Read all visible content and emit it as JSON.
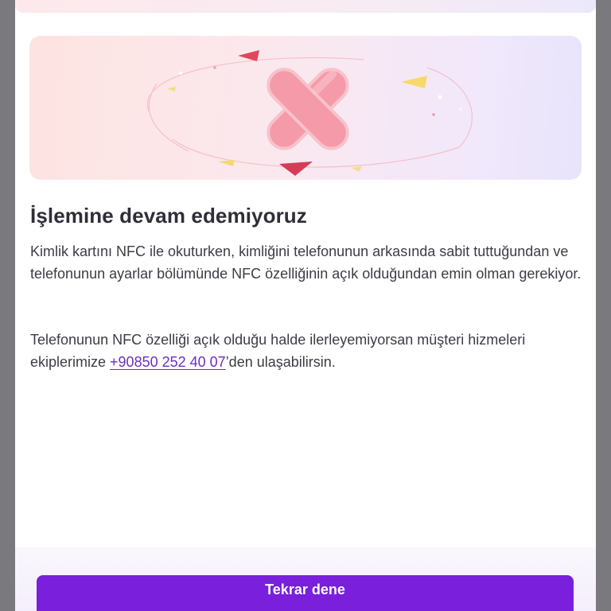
{
  "illustration": {
    "icon": "error-cross-icon",
    "background_colors": [
      "#fde4e1",
      "#e8e4fb"
    ]
  },
  "content": {
    "title": "İşlemine devam edemiyoruz",
    "paragraph_1": "Kimlik kartını NFC ile okuturken, kimliğini telefonunun arkasında sabit tuttuğundan ve telefonunun ayarlar bölümünde NFC özelliğinin açık olduğundan emin olman gerekiyor.",
    "paragraph_2_before": "Telefonunun NFC özelliği açık olduğu halde ilerleyemiyorsan müşteri hizmeleri ekiplerimize ",
    "phone_number": "+90850 252 40 07",
    "paragraph_2_after": "’den ulaşabilirsin."
  },
  "actions": {
    "retry_label": "Tekrar dene"
  },
  "colors": {
    "accent": "#7a1fdb",
    "link": "#6b2fbf",
    "title_text": "#2f2e38",
    "body_text": "#3d3c46"
  }
}
